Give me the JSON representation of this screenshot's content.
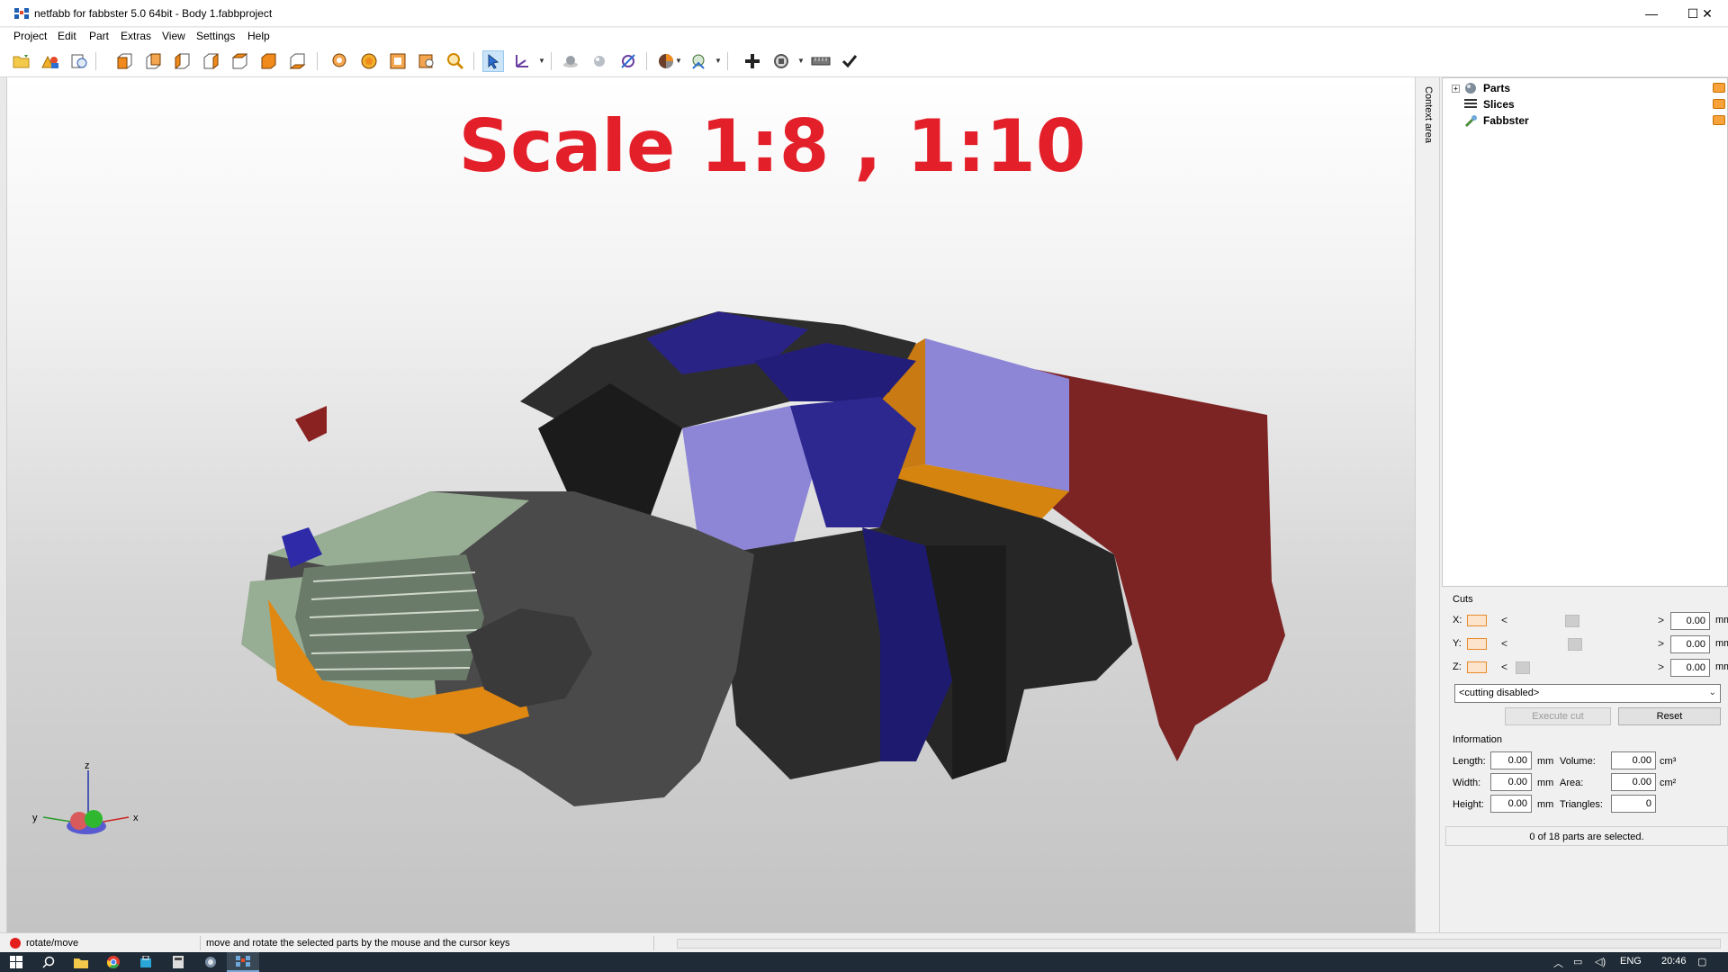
{
  "window": {
    "title": "netfabb for fabbster 5.0 64bit - Body 1.fabbproject",
    "minimize": "—",
    "maximize": "☐",
    "close": "✕"
  },
  "menu": [
    "Project",
    "Edit",
    "Part",
    "Extras",
    "View",
    "Settings",
    "Help"
  ],
  "viewport": {
    "overlay_text": "Scale 1:8 , 1:10",
    "overlay_color": "#e3202a",
    "axis_labels": {
      "x": "x",
      "y": "y",
      "z": "z"
    }
  },
  "context_area_label": "Context area",
  "tree": {
    "items": [
      {
        "label": "Parts",
        "expandable": true,
        "expand_symbol": "+"
      },
      {
        "label": "Slices",
        "expandable": false
      },
      {
        "label": "Fabbster",
        "expandable": false
      }
    ]
  },
  "cuts": {
    "title": "Cuts",
    "rows": [
      {
        "axis": "X:",
        "value": "0.00",
        "unit": "mm",
        "slider_fraction": 0.55
      },
      {
        "axis": "Y:",
        "value": "0.00",
        "unit": "mm",
        "slider_fraction": 0.58
      },
      {
        "axis": "Z:",
        "value": "0.00",
        "unit": "mm",
        "slider_fraction": 0.1
      }
    ],
    "arrow_left": "<",
    "arrow_right": ">",
    "mode": "<cutting disabled>",
    "execute_label": "Execute cut",
    "reset_label": "Reset"
  },
  "information": {
    "title": "Information",
    "length_label": "Length:",
    "length": "0.00",
    "length_unit": "mm",
    "width_label": "Width:",
    "width": "0.00",
    "width_unit": "mm",
    "height_label": "Height:",
    "height": "0.00",
    "height_unit": "mm",
    "volume_label": "Volume:",
    "volume": "0.00",
    "volume_unit": "cm³",
    "area_label": "Area:",
    "area": "0.00",
    "area_unit": "cm²",
    "triangles_label": "Triangles:",
    "triangles": "0",
    "selection": "0 of 18 parts are selected."
  },
  "status": {
    "mode": "rotate/move",
    "hint": "move and rotate the selected parts by the mouse and the cursor keys"
  },
  "taskbar": {
    "language": "ENG",
    "time": "20:46"
  }
}
